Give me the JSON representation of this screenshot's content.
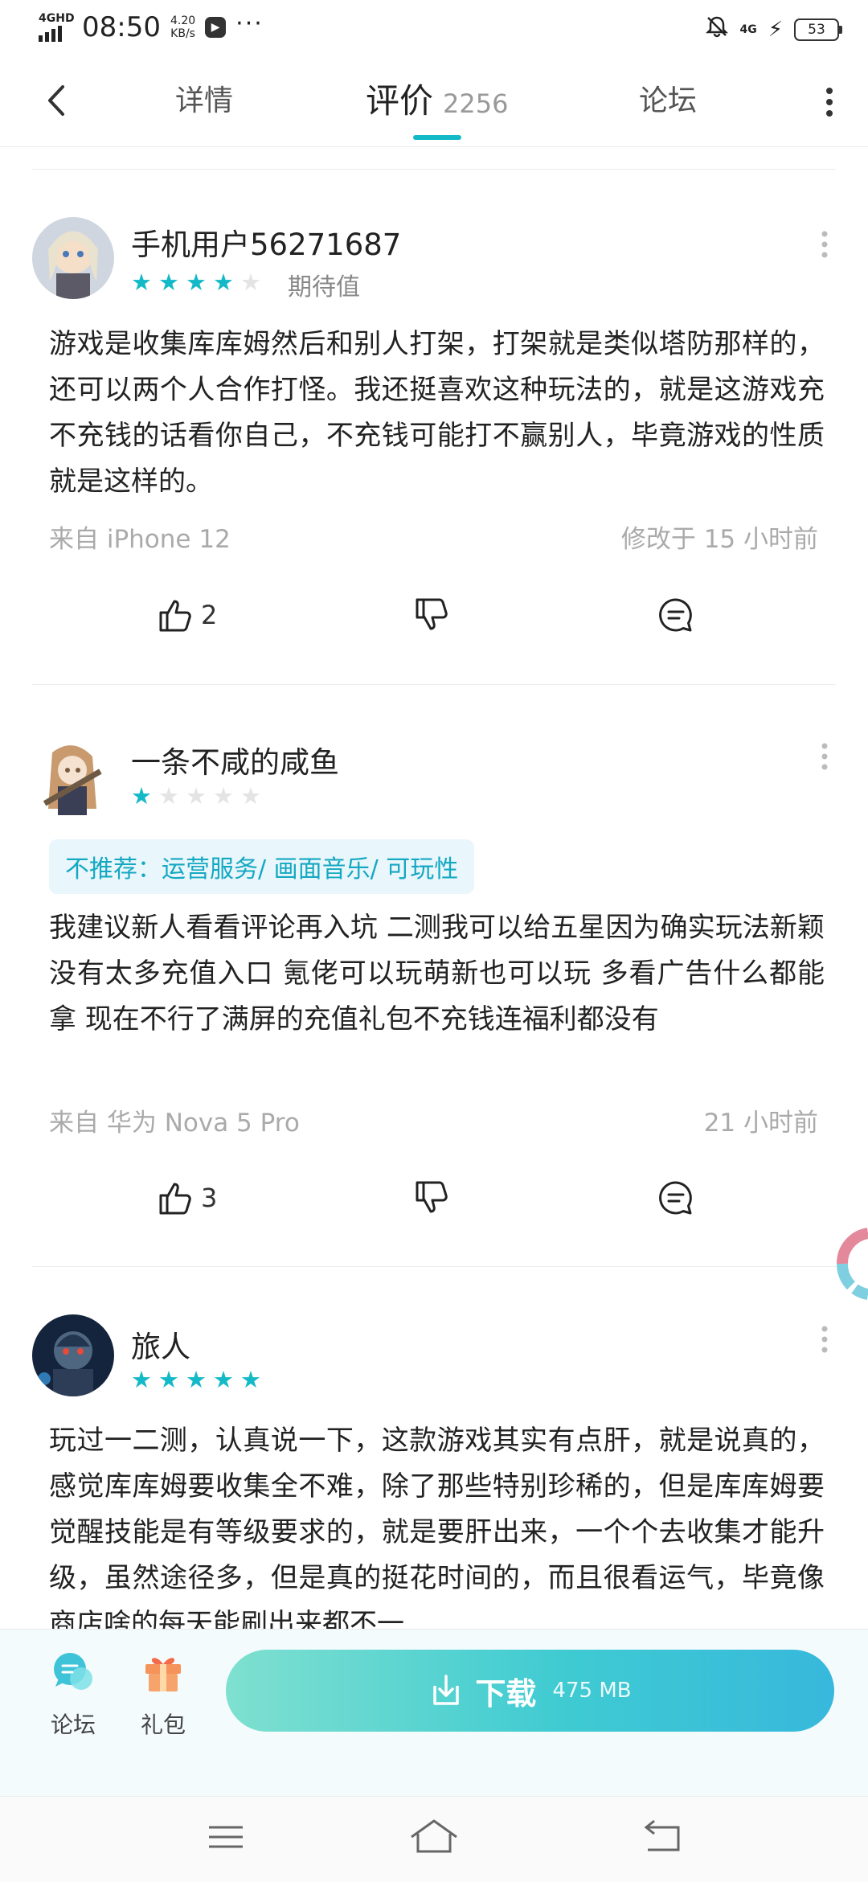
{
  "status_bar": {
    "network": "4GHD",
    "time": "08:50",
    "speed_value": "4.20",
    "speed_unit": "KB/s",
    "more": "···",
    "signal_type": "4G",
    "battery": "53"
  },
  "header": {
    "tabs": [
      {
        "label": "详情"
      },
      {
        "label": "评价",
        "count": "2256"
      },
      {
        "label": "论坛"
      }
    ],
    "active_tab": "评价",
    "accent_color": "#14b9c8"
  },
  "reviews": [
    {
      "username": "手机用户56271687",
      "rating": 4,
      "rating_label": "期待值",
      "text": "游戏是收集库库姆然后和别人打架，打架就是类似塔防那样的，还可以两个人合作打怪。我还挺喜欢这种玩法的，就是这游戏充不充钱的话看你自己，不充钱可能打不赢别人，毕竟游戏的性质就是这样的。",
      "device": "来自 iPhone 12",
      "time": "修改于 15 小时前",
      "likes": "2"
    },
    {
      "username": "一条不咸的咸鱼",
      "rating": 1,
      "tag": "不推荐：运营服务/ 画面音乐/ 可玩性",
      "text": "我建议新人看看评论再入坑 二测我可以给五星因为确实玩法新颖 没有太多充值入口 氪佬可以玩萌新也可以玩 多看广告什么都能拿 现在不行了满屏的充值礼包不充钱连福利都没有",
      "device": "来自 华为 Nova 5 Pro",
      "time": "21 小时前",
      "likes": "3"
    },
    {
      "username": "旅人",
      "rating": 5,
      "text": "玩过一二测，认真说一下，这款游戏其实有点肝，就是说真的，感觉库库姆要收集全不难，除了那些特别珍稀的，但是库库姆要觉醒技能是有等级要求的，就是要肝出来，一个个去收集才能升级，虽然途径多，但是真的挺花时间的，而且很看运气，毕竟像商店啥的每天能刷出来都不一"
    }
  ],
  "bottom_bar": {
    "forum_label": "论坛",
    "gift_label": "礼包",
    "download_label": "下载",
    "download_size": "475 MB"
  }
}
